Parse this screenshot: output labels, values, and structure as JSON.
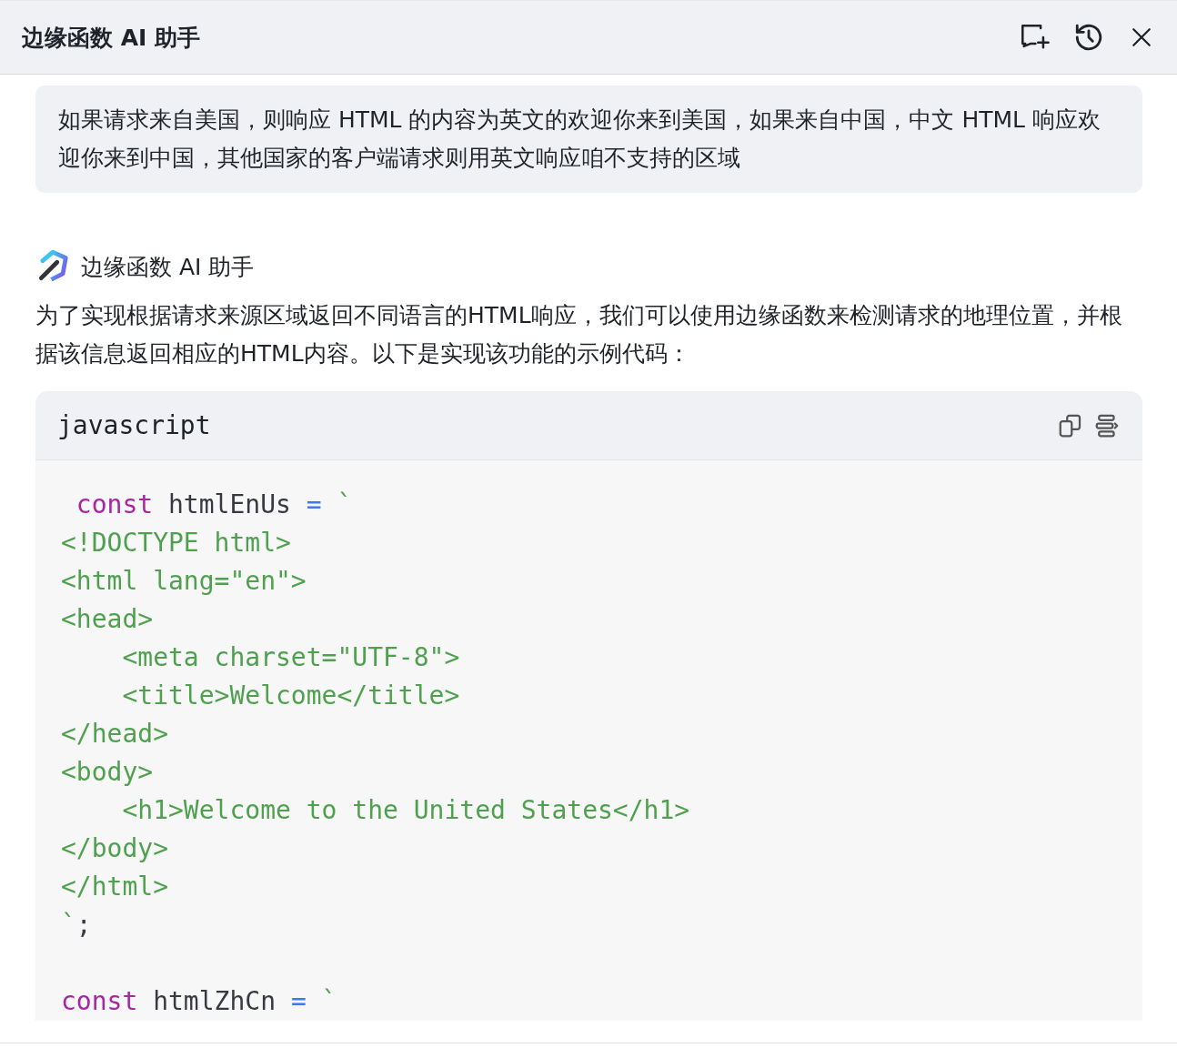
{
  "window": {
    "title": "边缘函数 AI 助手"
  },
  "user_message": "如果请求来自美国，则响应 HTML 的内容为英文的欢迎你来到美国，如果来自中国，中文 HTML 响应欢迎你来到中国，其他国家的客户端请求则用英文响应咱不支持的区域",
  "assistant": {
    "name": "边缘函数 AI 助手",
    "text": "为了实现根据请求来源区域返回不同语言的HTML响应，我们可以使用边缘函数来检测请求的地理位置，并根据该信息返回相应的HTML内容。以下是实现该功能的示例代码："
  },
  "code_block": {
    "language": "javascript",
    "statements": [
      [
        [
          {
            "kind": "keyword",
            "text": " const"
          },
          {
            "kind": "plain",
            "text": " htmlEnUs "
          },
          {
            "kind": "operator",
            "text": "="
          },
          {
            "kind": "string",
            "text": " `"
          }
        ],
        [
          {
            "kind": "string",
            "text": "<!DOCTYPE html>"
          }
        ],
        [
          {
            "kind": "string",
            "text": "<html lang=\"en\">"
          }
        ],
        [
          {
            "kind": "string",
            "text": "<head>"
          }
        ],
        [
          {
            "kind": "string",
            "text": "    <meta charset=\"UTF-8\">"
          }
        ],
        [
          {
            "kind": "string",
            "text": "    <title>Welcome</title>"
          }
        ],
        [
          {
            "kind": "string",
            "text": "</head>"
          }
        ],
        [
          {
            "kind": "string",
            "text": "<body>"
          }
        ],
        [
          {
            "kind": "string",
            "text": "    <h1>Welcome to the United States</h1>"
          }
        ],
        [
          {
            "kind": "string",
            "text": "</body>"
          }
        ],
        [
          {
            "kind": "string",
            "text": "</html>"
          }
        ],
        [
          {
            "kind": "string",
            "text": "`"
          },
          {
            "kind": "plain",
            "text": ";"
          }
        ]
      ],
      [
        [
          {
            "kind": "keyword",
            "text": "const"
          },
          {
            "kind": "plain",
            "text": " htmlZhCn "
          },
          {
            "kind": "operator",
            "text": "="
          },
          {
            "kind": "string",
            "text": " `"
          }
        ]
      ]
    ]
  }
}
